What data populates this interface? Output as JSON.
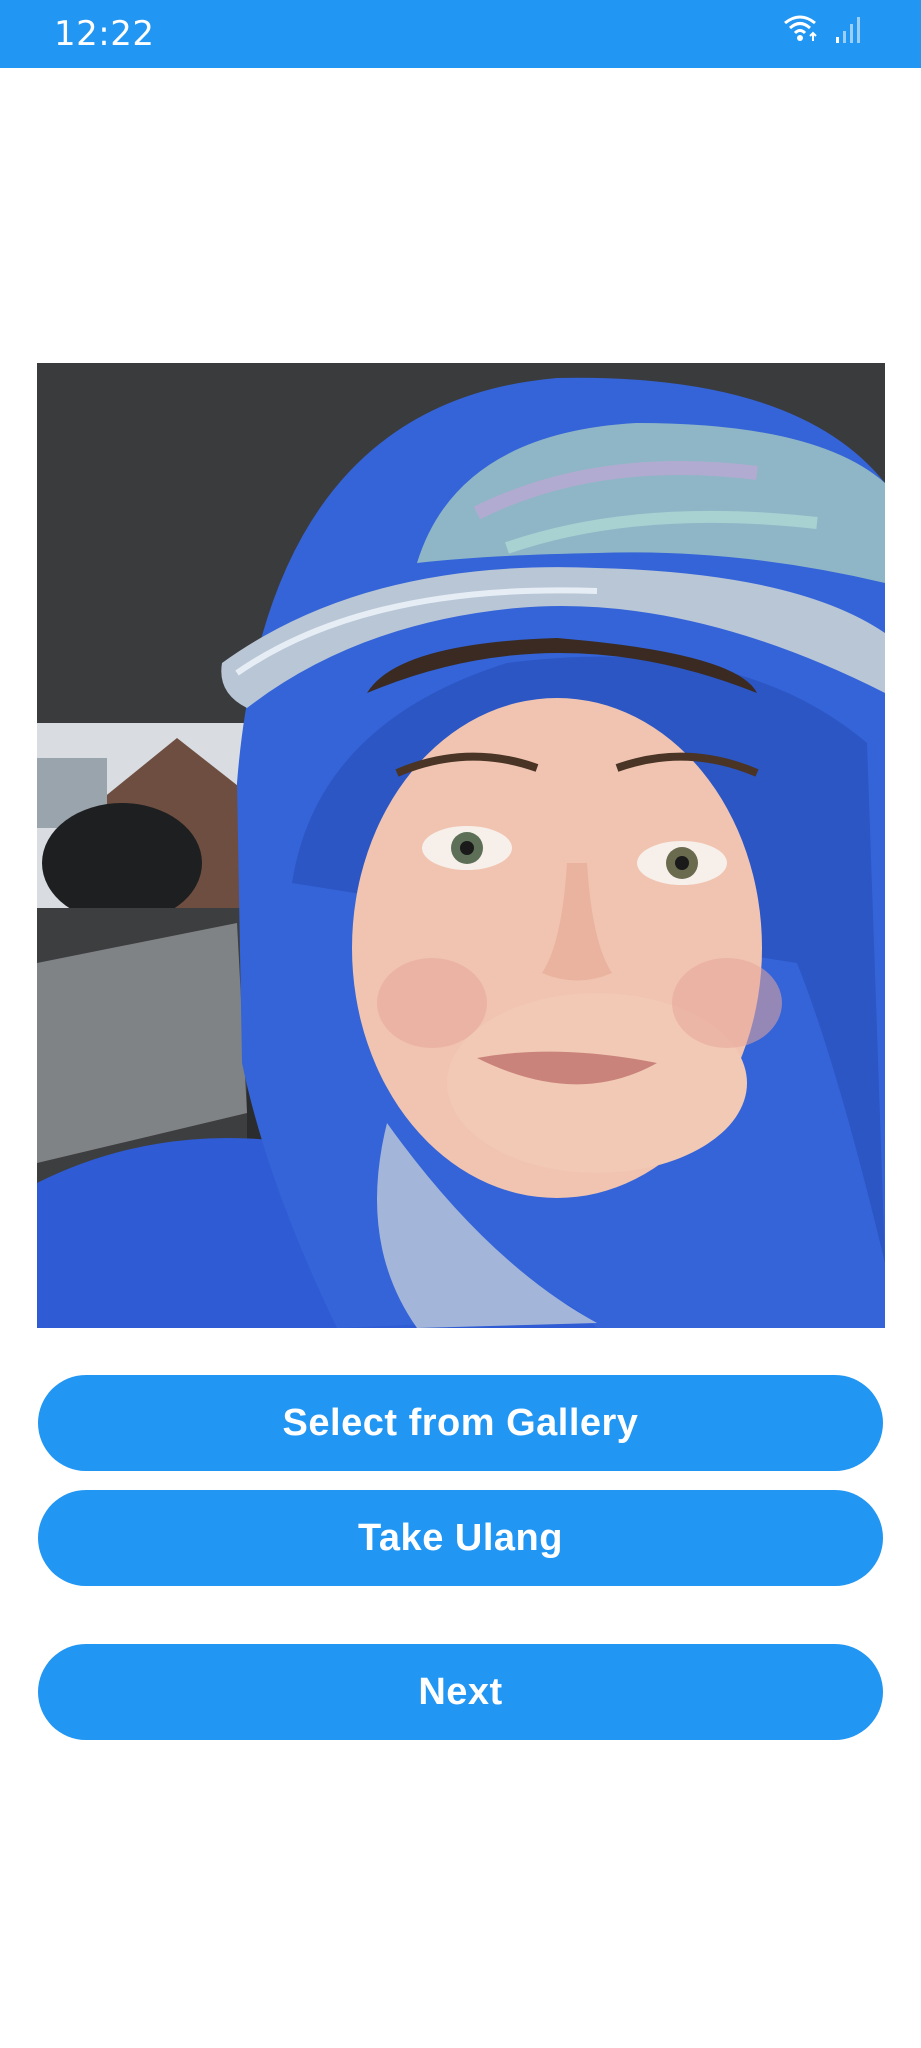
{
  "status_bar": {
    "time": "12:22",
    "background_color": "#2196F3",
    "icons": [
      "wifi-icon",
      "signal-icon"
    ]
  },
  "photo": {
    "description_icon": "selfie-photo"
  },
  "buttons": {
    "select_gallery": "Select from Gallery",
    "take_again": "Take Ulang",
    "next": "Next"
  },
  "colors": {
    "accent": "#2196F3",
    "button_text": "#FFFFFF"
  }
}
